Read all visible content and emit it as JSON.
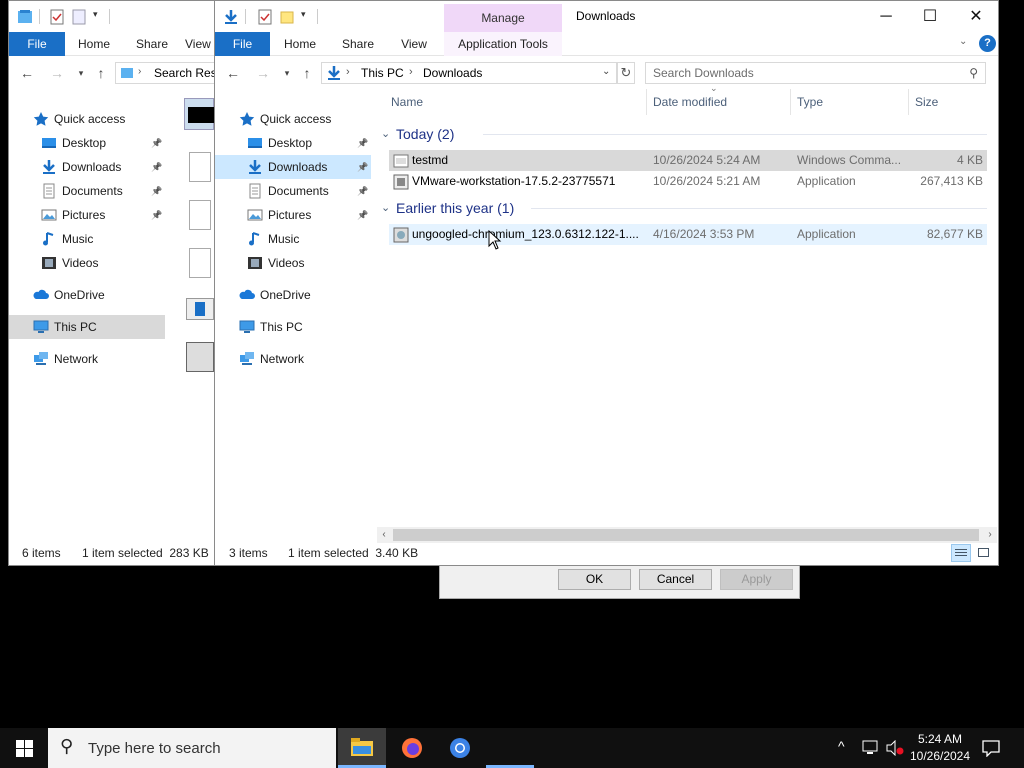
{
  "back_window": {
    "ribbon_tabs": [
      "File",
      "Home",
      "Share",
      "View"
    ],
    "address_text": "Search Resu",
    "nav": [
      {
        "label": "Quick access",
        "icon": "star-icon"
      },
      {
        "label": "Desktop",
        "icon": "desktop-folder-icon",
        "pinned": true
      },
      {
        "label": "Downloads",
        "icon": "downloads-folder-icon",
        "pinned": true
      },
      {
        "label": "Documents",
        "icon": "documents-folder-icon",
        "pinned": true
      },
      {
        "label": "Pictures",
        "icon": "pictures-folder-icon",
        "pinned": true
      },
      {
        "label": "Music",
        "icon": "music-icon"
      },
      {
        "label": "Videos",
        "icon": "videos-icon"
      },
      {
        "label": "OneDrive",
        "icon": "onedrive-icon"
      },
      {
        "label": "This PC",
        "icon": "this-pc-icon"
      },
      {
        "label": "Network",
        "icon": "network-icon"
      }
    ],
    "status_items": "6 items",
    "status_selected": "1 item selected  283 KB"
  },
  "front_window": {
    "title": "Downloads",
    "manage_label": "Manage",
    "ribbon_tabs": [
      "File",
      "Home",
      "Share",
      "View",
      "Application Tools"
    ],
    "breadcrumb": [
      "This PC",
      "Downloads"
    ],
    "search_placeholder": "Search Downloads",
    "nav": [
      {
        "label": "Quick access",
        "icon": "star-icon"
      },
      {
        "label": "Desktop",
        "icon": "desktop-folder-icon",
        "pinned": true
      },
      {
        "label": "Downloads",
        "icon": "downloads-folder-icon",
        "pinned": true,
        "selected": true
      },
      {
        "label": "Documents",
        "icon": "documents-folder-icon",
        "pinned": true
      },
      {
        "label": "Pictures",
        "icon": "pictures-folder-icon",
        "pinned": true
      },
      {
        "label": "Music",
        "icon": "music-icon"
      },
      {
        "label": "Videos",
        "icon": "videos-icon"
      },
      {
        "label": "OneDrive",
        "icon": "onedrive-icon"
      },
      {
        "label": "This PC",
        "icon": "this-pc-icon"
      },
      {
        "label": "Network",
        "icon": "network-icon"
      }
    ],
    "columns": [
      "Name",
      "Date modified",
      "Type",
      "Size"
    ],
    "groups": [
      {
        "label": "Today (2)",
        "files": [
          {
            "name": "testmd",
            "date": "10/26/2024 5:24 AM",
            "type": "Windows Comma...",
            "size": "4 KB",
            "icon": "cmd-script-icon",
            "state": "selected"
          },
          {
            "name": "VMware-workstation-17.5.2-23775571",
            "date": "10/26/2024 5:21 AM",
            "type": "Application",
            "size": "267,413 KB",
            "icon": "vmware-installer-icon",
            "state": "normal"
          }
        ]
      },
      {
        "label": "Earlier this year (1)",
        "files": [
          {
            "name": "ungoogled-chromium_123.0.6312.122-1....",
            "date": "4/16/2024 3:53 PM",
            "type": "Application",
            "size": "82,677 KB",
            "icon": "installer-icon",
            "state": "hover"
          }
        ]
      }
    ],
    "status_items": "3 items",
    "status_selected": "1 item selected  3.40 KB"
  },
  "dialog": {
    "ok_label": "OK",
    "cancel_label": "Cancel",
    "apply_label": "Apply"
  },
  "taskbar": {
    "search_placeholder": "Type here to search",
    "time": "5:24 AM",
    "date": "10/26/2024"
  },
  "colors": {
    "accent": "#1a6fc6",
    "manage_tab": "#f0d8f8",
    "selected_row": "#cce8ff",
    "taskbar": "#101010"
  }
}
